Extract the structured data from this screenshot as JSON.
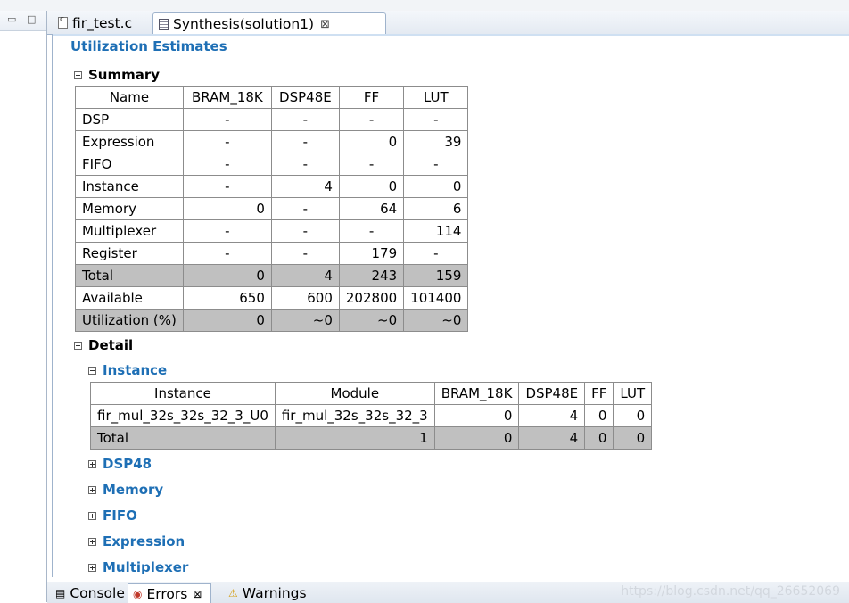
{
  "editor": {
    "tabs": [
      {
        "label": "fir_test.c",
        "active": false,
        "icon": "c-file-icon"
      },
      {
        "label": "Synthesis(solution1)",
        "active": true,
        "icon": "report-icon"
      }
    ],
    "close_glyph": "⊠"
  },
  "report": {
    "title": "Utilization Estimates",
    "summary": {
      "heading": "Summary",
      "columns": [
        "Name",
        "BRAM_18K",
        "DSP48E",
        "FF",
        "LUT"
      ],
      "rows": [
        {
          "cells": [
            "DSP",
            "-",
            "-",
            "-",
            "-"
          ],
          "highlight": false
        },
        {
          "cells": [
            "Expression",
            "-",
            "-",
            "0",
            "39"
          ],
          "highlight": false
        },
        {
          "cells": [
            "FIFO",
            "-",
            "-",
            "-",
            "-"
          ],
          "highlight": false
        },
        {
          "cells": [
            "Instance",
            "-",
            "4",
            "0",
            "0"
          ],
          "highlight": false
        },
        {
          "cells": [
            "Memory",
            "0",
            "-",
            "64",
            "6"
          ],
          "highlight": false
        },
        {
          "cells": [
            "Multiplexer",
            "-",
            "-",
            "-",
            "114"
          ],
          "highlight": false
        },
        {
          "cells": [
            "Register",
            "-",
            "-",
            "179",
            "-"
          ],
          "highlight": false
        },
        {
          "cells": [
            "Total",
            "0",
            "4",
            "243",
            "159"
          ],
          "highlight": true
        },
        {
          "cells": [
            "Available",
            "650",
            "600",
            "202800",
            "101400"
          ],
          "highlight": false
        },
        {
          "cells": [
            "Utilization (%)",
            "0",
            "~0",
            "~0",
            "~0"
          ],
          "highlight": true
        }
      ]
    },
    "detail": {
      "heading": "Detail",
      "instance": {
        "heading": "Instance",
        "columns": [
          "Instance",
          "Module",
          "BRAM_18K",
          "DSP48E",
          "FF",
          "LUT"
        ],
        "rows": [
          {
            "cells": [
              "fir_mul_32s_32s_32_3_U0",
              "fir_mul_32s_32s_32_3",
              "0",
              "4",
              "0",
              "0"
            ],
            "highlight": false
          },
          {
            "cells": [
              "Total",
              "",
              "1",
              "0",
              "4",
              "0",
              "0"
            ],
            "highlight": true
          }
        ]
      },
      "collapsed_sections": [
        "DSP48",
        "Memory",
        "FIFO",
        "Expression",
        "Multiplexer"
      ]
    }
  },
  "bottom_tabs": [
    {
      "label": "Console",
      "icon": "console-icon",
      "closable": false
    },
    {
      "label": "Errors",
      "icon": "error-icon",
      "closable": true
    },
    {
      "label": "Warnings",
      "icon": "warning-icon",
      "closable": false
    }
  ],
  "watermark": "https://blog.csdn.net/qq_26652069"
}
